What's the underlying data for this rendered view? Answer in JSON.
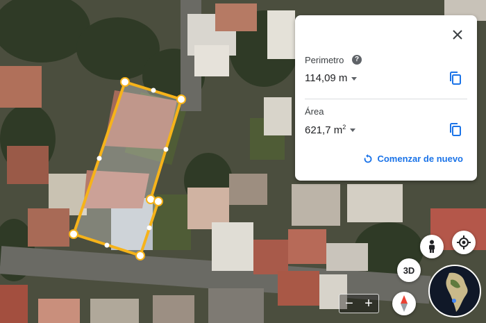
{
  "measure_panel": {
    "perimeter_label": "Perimetro",
    "perimeter_value": "114,09 m",
    "area_label": "Área",
    "area_value": "621,7 m",
    "area_unit_power": "2",
    "restart_label": "Comenzar de nuevo",
    "help_glyph": "?"
  },
  "controls": {
    "btn_3d": "3D",
    "zoom_out": "−",
    "zoom_in": "+"
  },
  "icons": [
    "close-icon",
    "help-icon",
    "copy-icon",
    "restart-icon",
    "pegman-icon",
    "my-location-icon",
    "compass-icon",
    "globe-icon"
  ],
  "colors": {
    "polygon_stroke": "#f6b31a",
    "accent": "#1a73e8"
  }
}
